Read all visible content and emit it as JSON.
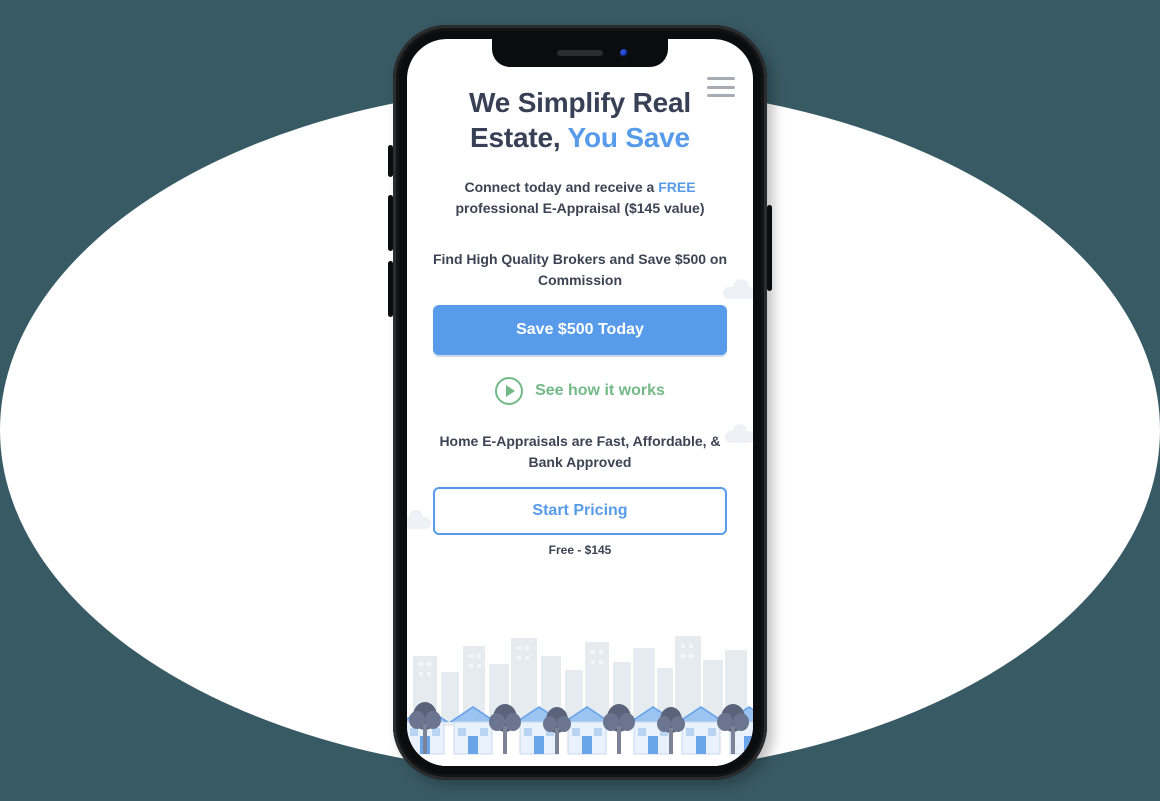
{
  "colors": {
    "page_bg": "#385a64",
    "phone_body": "#0b0c0d",
    "accent_blue": "#579bea",
    "accent_green": "#73b988",
    "text_dark": "#374055"
  },
  "hero": {
    "headline_plain": "We Simplify Real Estate, ",
    "headline_accent": "You Save",
    "subhead_pre": "Connect today and receive a ",
    "subhead_free": "FREE",
    "subhead_post": " professional E-Appraisal ($145 value)",
    "broker_text": "Find High Quality Brokers and Save $500 on Commission",
    "cta_primary": "Save $500 Today",
    "video_label": "See how it works",
    "appraisal_text": "Home E-Appraisals are Fast, Affordable, & Bank Approved",
    "cta_secondary": "Start Pricing",
    "price_label": "Free - $145"
  }
}
